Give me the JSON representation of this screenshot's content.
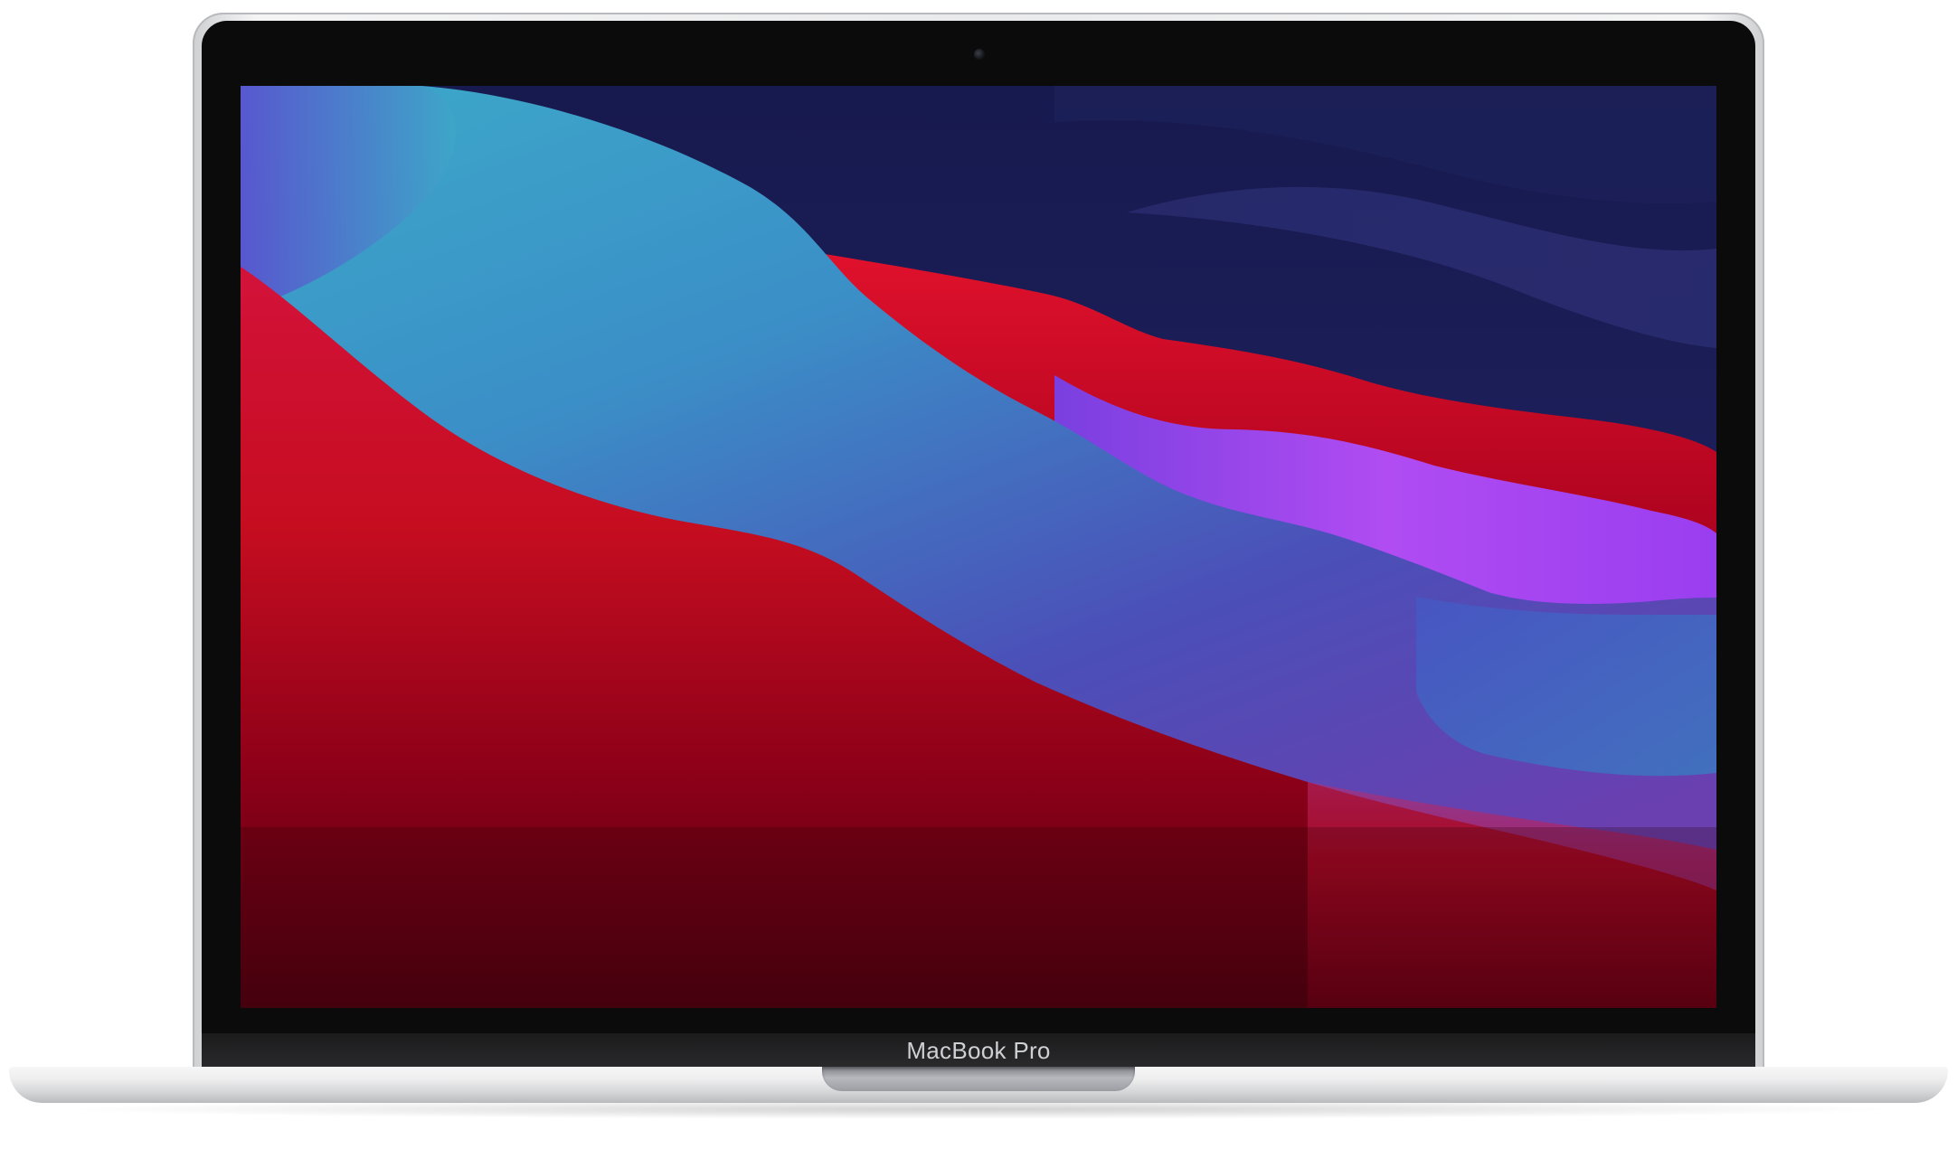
{
  "device": {
    "model_label": "MacBook Pro"
  },
  "icons": {
    "camera": "camera-icon"
  },
  "colors": {
    "bezel": "#0b0b0c",
    "aluminium": "#e9eaeb",
    "wallpaper_navy": "#1a1b4a",
    "wallpaper_teal": "#3aa6c8",
    "wallpaper_red": "#e10f2b",
    "wallpaper_purple": "#a94df0",
    "wallpaper_dark_red": "#5a0010"
  }
}
